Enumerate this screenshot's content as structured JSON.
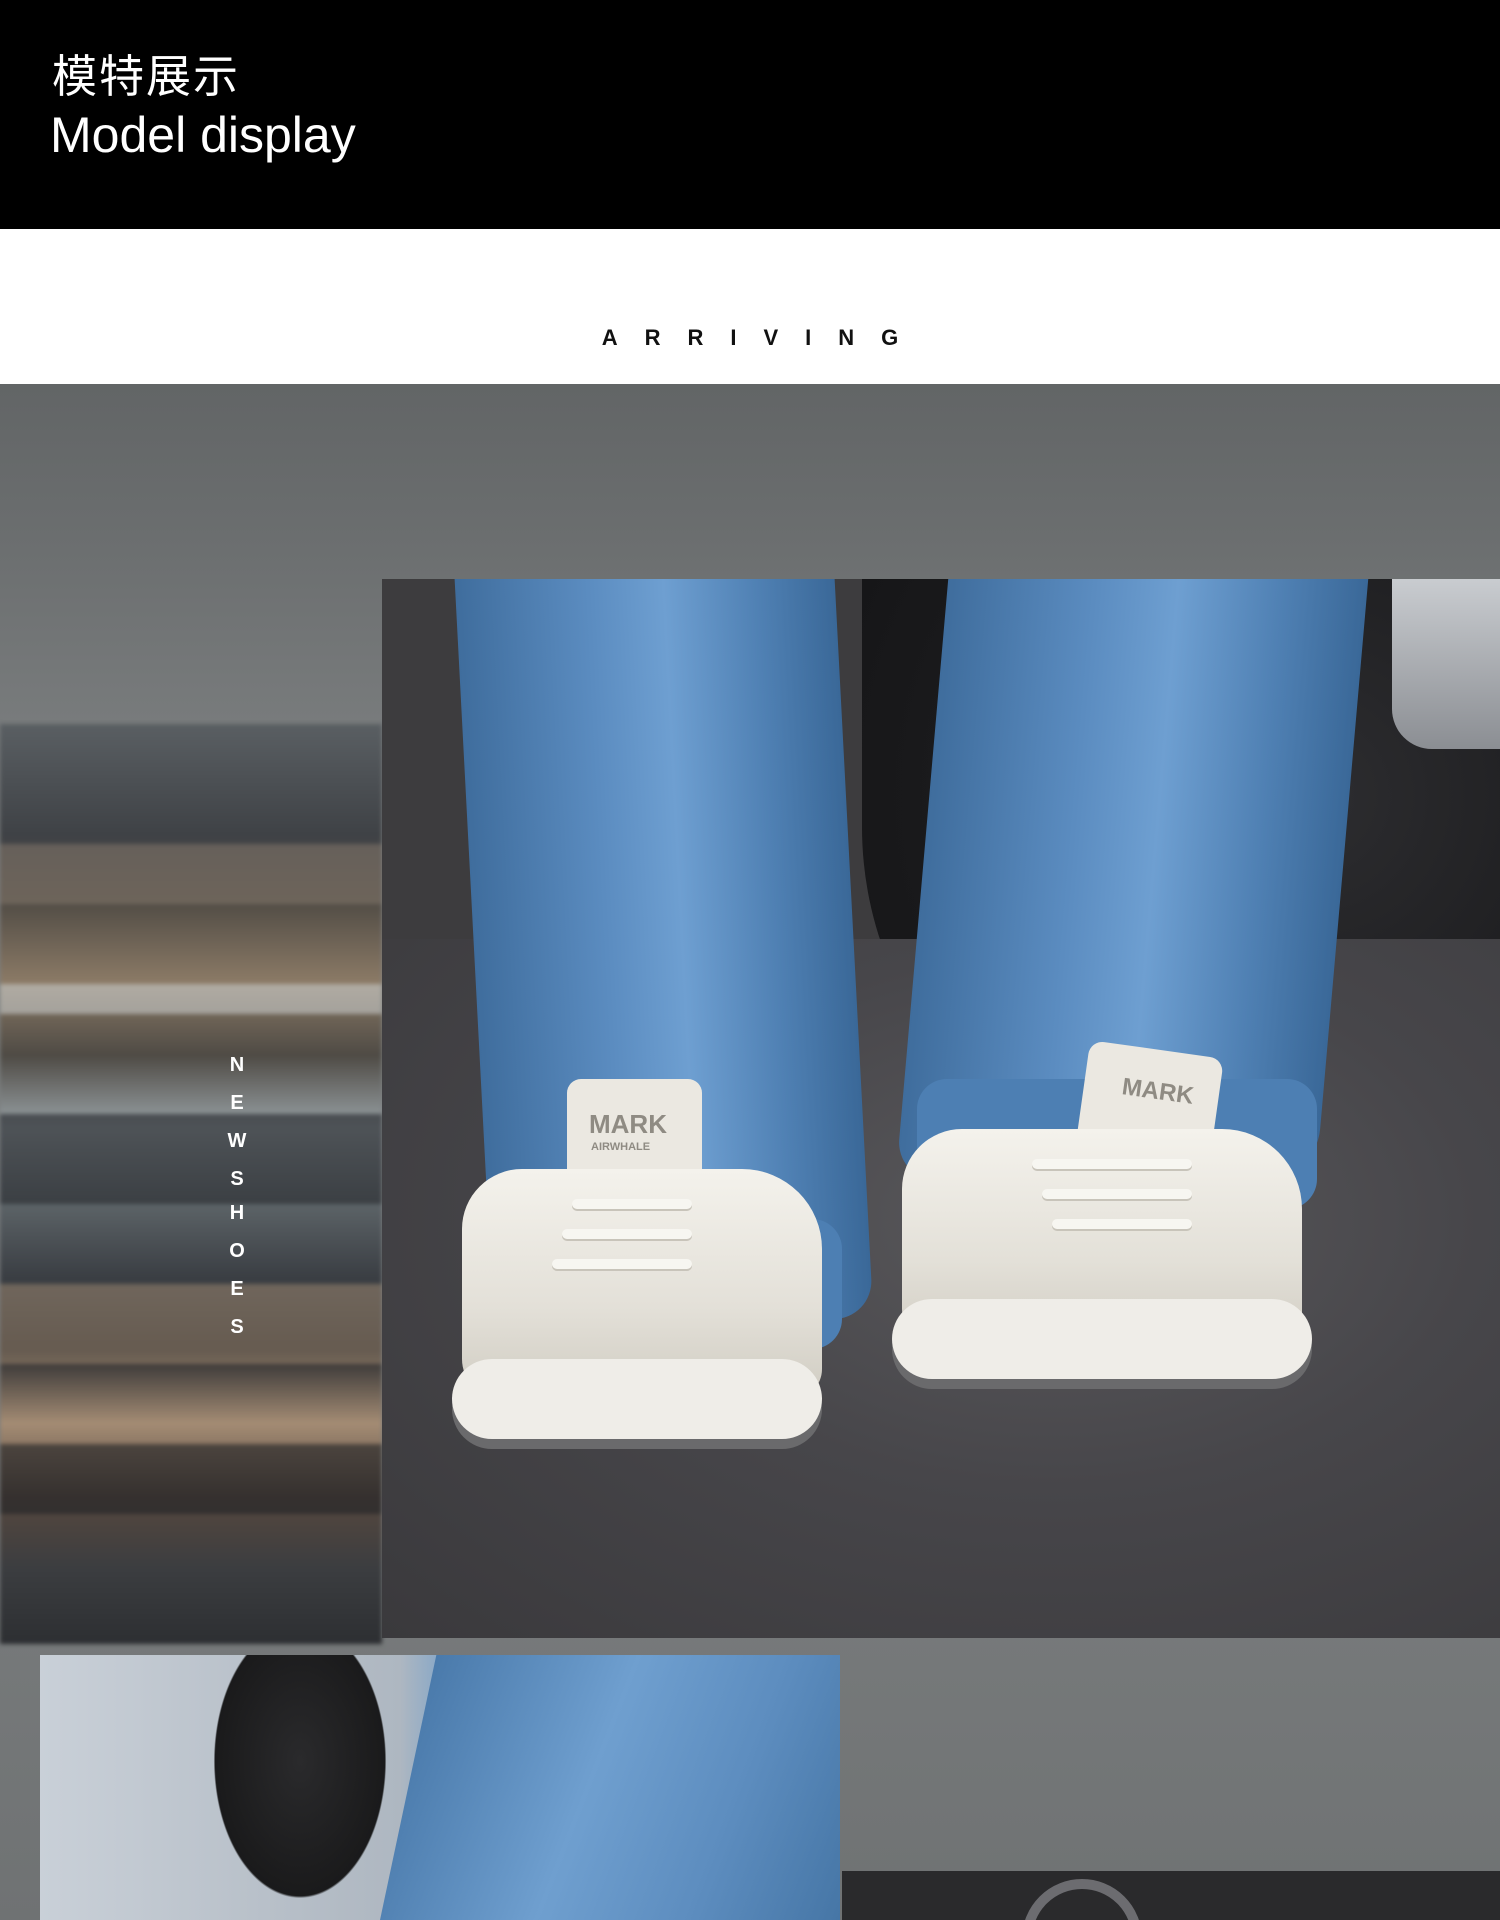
{
  "header": {
    "title_cn": "模特展示",
    "title_en": "Model display"
  },
  "banner": {
    "arriving": "ARRIVING"
  },
  "vertical_label": {
    "letters": [
      "N",
      "E",
      "W",
      "S",
      "H",
      "O",
      "E",
      "S"
    ]
  },
  "product": {
    "brand_tag": "MARK",
    "brand_sub": "AIRWHALE"
  },
  "colors": {
    "header_bg": "#000000",
    "page_bg": "#ffffff",
    "gallery_bg": "#7a7d7e",
    "denim": "#5b8cc0"
  }
}
